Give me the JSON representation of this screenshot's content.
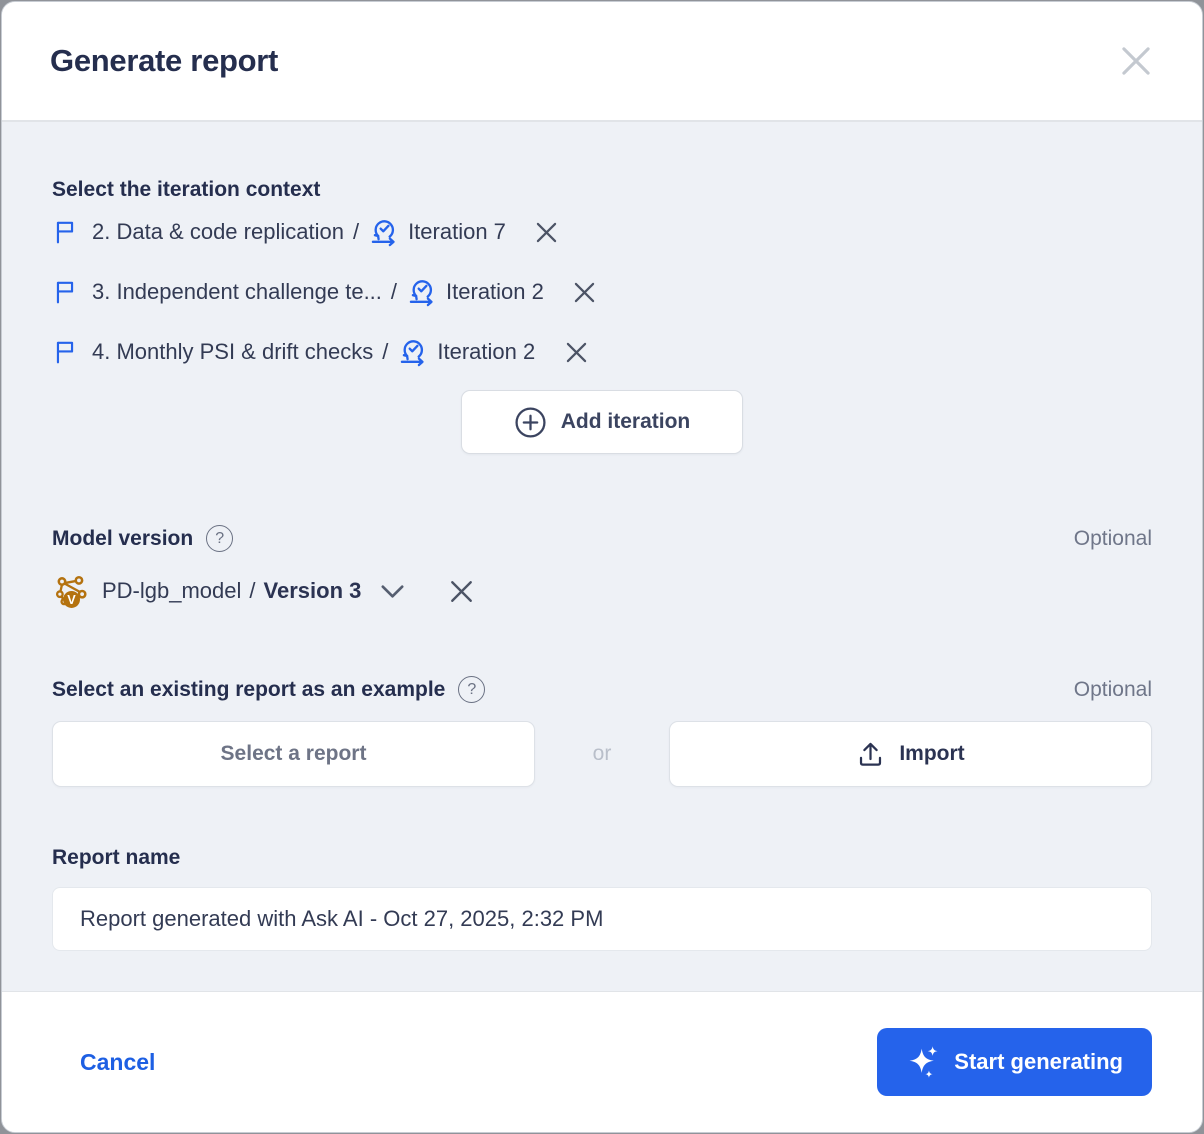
{
  "modal": {
    "title": "Generate report"
  },
  "iteration_section": {
    "heading": "Select the iteration context",
    "separator": "/",
    "items": [
      {
        "name": "2. Data & code replication",
        "iteration": "Iteration 7"
      },
      {
        "name": "3. Independent challenge te...",
        "iteration": "Iteration 2"
      },
      {
        "name": "4. Monthly PSI & drift checks",
        "iteration": "Iteration 2"
      }
    ],
    "add_button_label": "Add iteration"
  },
  "model_section": {
    "label": "Model version",
    "help_glyph": "?",
    "optional_label": "Optional",
    "model_name": "PD-lgb_model",
    "separator": "/",
    "version": "Version 3"
  },
  "example_section": {
    "label": "Select an existing report as an example",
    "help_glyph": "?",
    "optional_label": "Optional",
    "select_button_label": "Select a report",
    "or_label": "or",
    "import_button_label": "Import"
  },
  "report_name_section": {
    "label": "Report name",
    "value": "Report generated with Ask AI - Oct 27, 2025, 2:32 PM"
  },
  "footer": {
    "cancel_label": "Cancel",
    "submit_label": "Start generating"
  },
  "colors": {
    "accent_blue": "#2563eb",
    "title_navy": "#252e4e",
    "model_icon_orange": "#b4720f",
    "body_background": "#eef1f6"
  }
}
